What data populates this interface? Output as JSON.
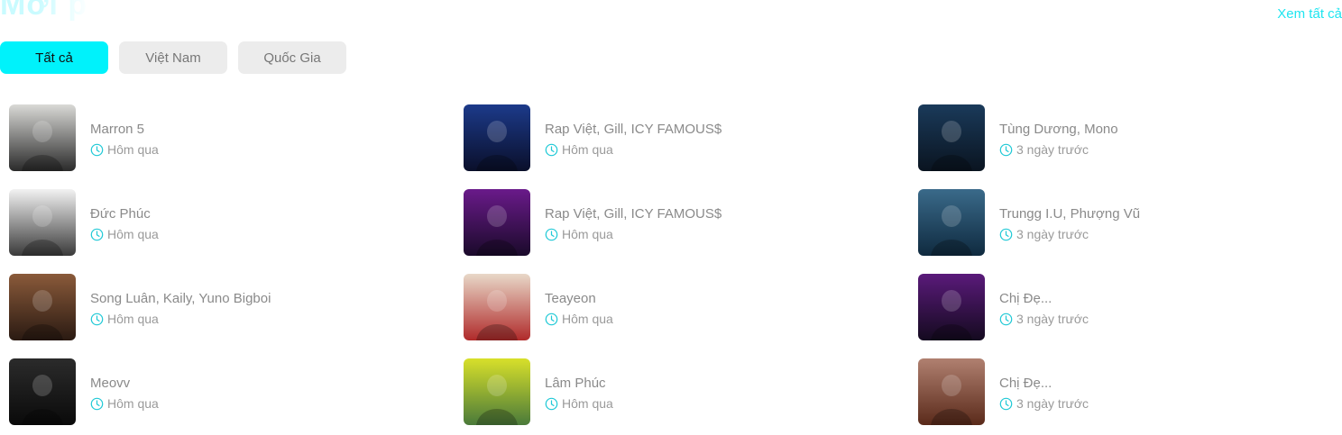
{
  "header": {
    "title": "Mới phát hành",
    "see_all": "Xem tất cả"
  },
  "tabs": [
    {
      "label": "Tất cả",
      "active": true
    },
    {
      "label": "Việt Nam",
      "active": false
    },
    {
      "label": "Quốc Gia",
      "active": false
    }
  ],
  "columns": [
    [
      {
        "artist": "Marron 5",
        "time": "Hôm qua",
        "thumb_colors": [
          "#d9d9d6",
          "#2a2a2a"
        ]
      },
      {
        "artist": "Đức Phúc",
        "time": "Hôm qua",
        "thumb_colors": [
          "#f2f2f2",
          "#3a3a3a"
        ]
      },
      {
        "artist": "Song Luân, Kaily, Yuno Bigboi",
        "time": "Hôm qua",
        "thumb_colors": [
          "#8a5a3a",
          "#2a1a12"
        ]
      },
      {
        "artist": "Meovv",
        "time": "Hôm qua",
        "thumb_colors": [
          "#2b2b2b",
          "#0a0a0a"
        ]
      }
    ],
    [
      {
        "artist": "Rap Việt, Gill, ICY FAMOUS$",
        "time": "Hôm qua",
        "thumb_colors": [
          "#1c3a8a",
          "#0a0f2a"
        ]
      },
      {
        "artist": "Rap Việt, Gill, ICY FAMOUS$",
        "time": "Hôm qua",
        "thumb_colors": [
          "#6a1a8a",
          "#1a0a2a"
        ]
      },
      {
        "artist": "Teayeon",
        "time": "Hôm qua",
        "thumb_colors": [
          "#e8d8c8",
          "#b02a2a"
        ]
      },
      {
        "artist": "Lâm Phúc",
        "time": "Hôm qua",
        "thumb_colors": [
          "#d8e02a",
          "#4a7a3a"
        ]
      }
    ],
    [
      {
        "artist": "Tùng Dương, Mono",
        "time": "3 ngày trước",
        "thumb_colors": [
          "#1a3a5a",
          "#0a1420"
        ]
      },
      {
        "artist": "Trungg I.U, Phượng Vũ",
        "time": "3 ngày trước",
        "thumb_colors": [
          "#3a6a8a",
          "#0f2a3f"
        ]
      },
      {
        "artist": "Chị Đẹ...",
        "time": "3 ngày trước",
        "thumb_colors": [
          "#5a1a7a",
          "#140a1f"
        ]
      },
      {
        "artist": "Chị Đẹ...",
        "time": "3 ngày trước",
        "thumb_colors": [
          "#b08070",
          "#5a2a1a"
        ]
      }
    ]
  ],
  "colors": {
    "accent": "#00f2fb",
    "link": "#1fe5f0",
    "tab_inactive": "#ececec"
  },
  "icons": {
    "time": "clock-icon"
  }
}
